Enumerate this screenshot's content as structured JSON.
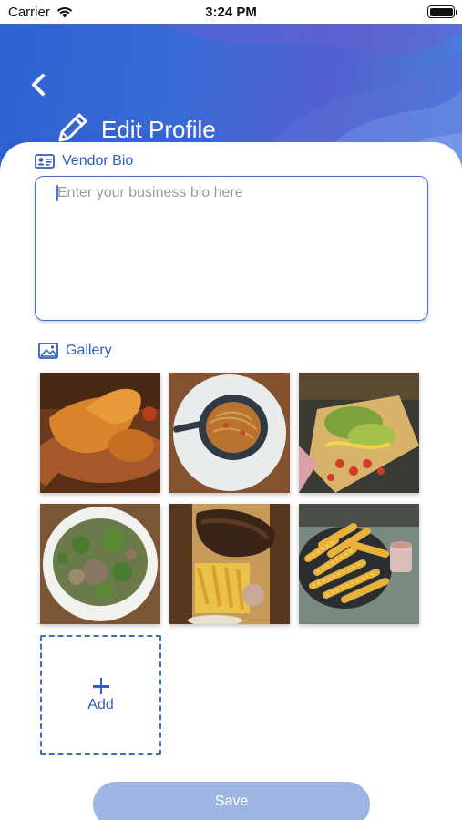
{
  "status_bar": {
    "carrier": "Carrier",
    "time": "3:24 PM"
  },
  "header": {
    "title": "Edit Profile"
  },
  "vendor_bio": {
    "label": "Vendor Bio",
    "placeholder": "Enter your business bio here",
    "value": ""
  },
  "gallery": {
    "label": "Gallery",
    "photos": [
      "fried-food-photo",
      "noodle-bowl-photo",
      "nachos-photo",
      "salad-plate-photo",
      "grilled-meat-fries-photo",
      "crinkle-fries-photo"
    ],
    "add_label": "Add"
  },
  "save_label": "Save",
  "colors": {
    "accent": "#2f5fbf",
    "header_start": "#2f63d2",
    "header_end": "#4a80de",
    "save_disabled": "#9db6e6"
  }
}
